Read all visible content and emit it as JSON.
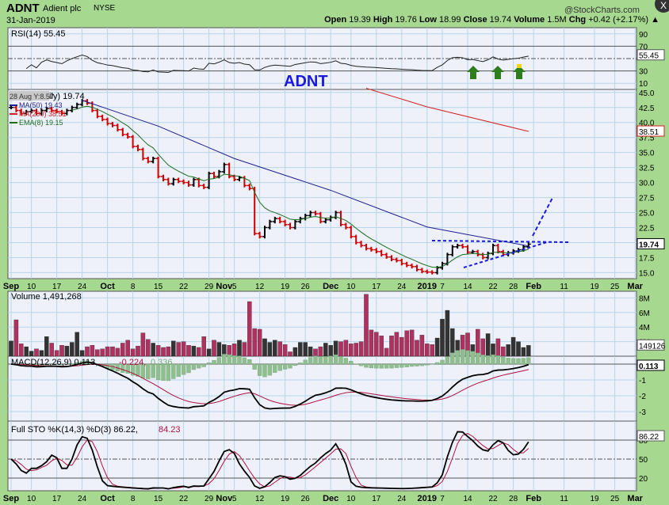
{
  "header": {
    "symbol": "ADNT",
    "name": "Adient plc",
    "exchange": "NYSE",
    "date": "31-Jan-2019",
    "brand": "@StockCharts.com",
    "quote": {
      "open_label": "Open",
      "open": "19.39",
      "high_label": "High",
      "high": "19.76",
      "low_label": "Low",
      "low": "18.99",
      "close_label": "Close",
      "close": "19.74",
      "volume_label": "Volume",
      "volume": "1.5M",
      "chg_label": "Chg",
      "chg": "+0.42 (+2.17%)"
    },
    "close_button": "X"
  },
  "annotation": {
    "ticker_text": "ADNT",
    "tooltip": "28 Aug Y:8.57",
    "colors": {
      "arrow": "#2e7d1e",
      "annotation": "#1a1adf"
    }
  },
  "chart_data": {
    "type": "ohlc",
    "dates": [
      "2018-09-04",
      "2018-09-05",
      "2018-09-06",
      "2018-09-07",
      "2018-09-10",
      "2018-09-11",
      "2018-09-12",
      "2018-09-13",
      "2018-09-14",
      "2018-09-17",
      "2018-09-18",
      "2018-09-19",
      "2018-09-20",
      "2018-09-21",
      "2018-09-24",
      "2018-09-25",
      "2018-09-26",
      "2018-09-27",
      "2018-09-28",
      "2018-10-01",
      "2018-10-02",
      "2018-10-03",
      "2018-10-04",
      "2018-10-05",
      "2018-10-08",
      "2018-10-09",
      "2018-10-10",
      "2018-10-11",
      "2018-10-12",
      "2018-10-15",
      "2018-10-16",
      "2018-10-17",
      "2018-10-18",
      "2018-10-19",
      "2018-10-22",
      "2018-10-23",
      "2018-10-24",
      "2018-10-25",
      "2018-10-26",
      "2018-10-29",
      "2018-10-30",
      "2018-10-31",
      "2018-11-01",
      "2018-11-02",
      "2018-11-05",
      "2018-11-06",
      "2018-11-07",
      "2018-11-08",
      "2018-11-09",
      "2018-11-12",
      "2018-11-13",
      "2018-11-14",
      "2018-11-15",
      "2018-11-16",
      "2018-11-19",
      "2018-11-20",
      "2018-11-21",
      "2018-11-23",
      "2018-11-26",
      "2018-11-27",
      "2018-11-28",
      "2018-11-29",
      "2018-11-30",
      "2018-12-03",
      "2018-12-04",
      "2018-12-06",
      "2018-12-07",
      "2018-12-10",
      "2018-12-11",
      "2018-12-12",
      "2018-12-13",
      "2018-12-14",
      "2018-12-17",
      "2018-12-18",
      "2018-12-19",
      "2018-12-20",
      "2018-12-21",
      "2018-12-24",
      "2018-12-26",
      "2018-12-27",
      "2018-12-28",
      "2018-12-31",
      "2019-01-02",
      "2019-01-03",
      "2019-01-04",
      "2019-01-07",
      "2019-01-08",
      "2019-01-09",
      "2019-01-10",
      "2019-01-11",
      "2019-01-14",
      "2019-01-15",
      "2019-01-16",
      "2019-01-17",
      "2019-01-18",
      "2019-01-22",
      "2019-01-23",
      "2019-01-24",
      "2019-01-25",
      "2019-01-28",
      "2019-01-29",
      "2019-01-30",
      "2019-01-31"
    ],
    "close": [
      42.5,
      42,
      41.5,
      41.8,
      42,
      41.5,
      42,
      42.3,
      42,
      41.8,
      41.5,
      42,
      42.5,
      43,
      43.6,
      43.2,
      42,
      41,
      40.5,
      39.8,
      39.5,
      38.8,
      38,
      37.6,
      36,
      35.5,
      34,
      33.5,
      34,
      31,
      30.5,
      29.8,
      30.5,
      30.2,
      30,
      29.6,
      30.5,
      29.5,
      29.2,
      31.5,
      31,
      31.8,
      33,
      31,
      30.5,
      30.8,
      29.5,
      29,
      21.5,
      21,
      22.5,
      23.5,
      24,
      23.5,
      23,
      22.5,
      23.5,
      24,
      24.5,
      25,
      24.8,
      23.5,
      23.8,
      24.2,
      25,
      23,
      22.5,
      21,
      20,
      19.5,
      19,
      18.8,
      18.5,
      18,
      17.6,
      17.2,
      17,
      16.5,
      16.2,
      16,
      15.5,
      15.2,
      15.1,
      15,
      15.8,
      16.5,
      18,
      19.3,
      19.5,
      19.3,
      18.4,
      18.5,
      18,
      17.5,
      18.2,
      19.5,
      18.5,
      18,
      18.3,
      18.6,
      18.8,
      19.3,
      19.74
    ],
    "volume_millions": [
      2.1,
      5.0,
      1.7,
      1.3,
      0.7,
      1.0,
      0.8,
      2.7,
      1.8,
      0.8,
      1.5,
      1.4,
      1.9,
      3.3,
      0.8,
      1.3,
      1.5,
      0.9,
      1.0,
      1.3,
      1.3,
      1.1,
      1.8,
      2.2,
      1.0,
      1.4,
      3.2,
      2.3,
      1.8,
      1.5,
      1.2,
      1.3,
      2.1,
      1.9,
      2.0,
      1.5,
      1.4,
      1.2,
      2.7,
      1.0,
      2.2,
      1.9,
      1.6,
      1.5,
      1.7,
      2.2,
      1.9,
      7.5,
      3.8,
      3.7,
      2.4,
      1.9,
      2.2,
      2.0,
      1.6,
      0.6,
      1.2,
      1.9,
      1.9,
      1.3,
      1.0,
      1.3,
      1.8,
      1.5,
      2.1,
      2.0,
      2.2,
      1.7,
      1.8,
      2.0,
      8.5,
      3.6,
      3.3,
      2.8,
      1.1,
      2.8,
      3.3,
      2.6,
      3.5,
      3.6,
      2.2,
      2.9,
      1.7,
      1.6,
      2.5,
      5.1,
      6.3,
      3.8,
      2.2,
      2.9,
      3.2,
      1.6,
      3.7,
      2.4,
      3.1,
      1.7,
      2.4,
      1.3,
      1.6,
      2.6,
      2.0,
      1.2,
      1.49
    ],
    "ma50": [
      [
        "2018-09-24",
        43.7
      ],
      [
        "2018-10-15",
        39.4
      ],
      [
        "2018-11-05",
        34.0
      ],
      [
        "2018-12-03",
        28.7
      ],
      [
        "2019-01-02",
        22.6
      ],
      [
        "2019-01-31",
        19.43
      ]
    ],
    "ma200": [
      [
        "2018-12-13",
        45.7
      ],
      [
        "2019-01-02",
        42.6
      ],
      [
        "2019-01-31",
        38.51
      ]
    ],
    "x_ticks": [
      [
        "Sep",
        "2018-09-04",
        true
      ],
      [
        "10",
        "2018-09-10",
        false
      ],
      [
        "17",
        "2018-09-17",
        false
      ],
      [
        "24",
        "2018-09-24",
        false
      ],
      [
        "Oct",
        "2018-10-01",
        true
      ],
      [
        "8",
        "2018-10-08",
        false
      ],
      [
        "15",
        "2018-10-15",
        false
      ],
      [
        "22",
        "2018-10-22",
        false
      ],
      [
        "29",
        "2018-10-29",
        false
      ],
      [
        "Nov",
        "2018-11-01",
        true
      ],
      [
        "5",
        "2018-11-05",
        false
      ],
      [
        "12",
        "2018-11-12",
        false
      ],
      [
        "19",
        "2018-11-19",
        false
      ],
      [
        "26",
        "2018-11-26",
        false
      ],
      [
        "Dec",
        "2018-12-03",
        true
      ],
      [
        "10",
        "2018-12-10",
        false
      ],
      [
        "17",
        "2018-12-17",
        false
      ],
      [
        "24",
        "2018-12-24",
        false
      ],
      [
        "2019",
        "2019-01-02",
        true
      ],
      [
        "7",
        "2019-01-07",
        false
      ],
      [
        "14",
        "2019-01-14",
        false
      ],
      [
        "22",
        "2019-01-22",
        false
      ],
      [
        "28",
        "2019-01-28",
        false
      ],
      [
        "Feb",
        "2019-02-01",
        true
      ],
      [
        "11",
        "2019-02-11",
        false
      ],
      [
        "19",
        "2019-02-19",
        false
      ],
      [
        "25",
        "2019-02-25",
        false
      ],
      [
        "Mar",
        "2019-03-01",
        true
      ]
    ],
    "price_axis": {
      "ylim": [
        14,
        46
      ],
      "ticks": [
        "15.0",
        "17.5",
        "20.0",
        "22.5",
        "25.0",
        "27.5",
        "30.0",
        "32.5",
        "35.0",
        "37.5",
        "40.0",
        "42.5",
        "45.0"
      ]
    },
    "price_legend": {
      "title_tail": "ily) 19.74",
      "ma50": "MA(50) 19.43",
      "ma200": "MA(200) 38.51",
      "ema8": "EMA(8) 19.15"
    },
    "price_tags": {
      "close": "19.74",
      "ma200": "38.51"
    },
    "rsi": {
      "label": "RSI(14) 55.45",
      "tag": "55.45",
      "ticks": [
        "90",
        "70",
        "30",
        "10"
      ]
    },
    "volume": {
      "label": "Volume 1,491,268",
      "tag": "149126",
      "ticks": [
        "8M",
        "6M",
        "4M",
        "2M"
      ]
    },
    "macd": {
      "label": "MACD(12,26,9) 0.113,",
      "signal": "-0.224,",
      "hist": "0.336",
      "tags": [
        "0.336",
        "0.113",
        "-0.224"
      ],
      "ticks": [
        "-1",
        "-2",
        "-3"
      ]
    },
    "sto": {
      "label": "Full STO %K(14,3) %D(3) 86.22,",
      "d": "84.23",
      "tag": "86.22",
      "ticks": [
        "80",
        "50",
        "20"
      ]
    },
    "colors": {
      "up": "#000000",
      "down": "#cc0000",
      "vol_up": "#333333",
      "vol_down": "#b03060",
      "ma50": "#1f1f8f",
      "ma200": "#d42020",
      "ema8": "#1e6e1e",
      "macd_hist": "#8fbf8f",
      "signal": "#b01040",
      "panel_bg": "#eef1fa",
      "grid": "#b7d6ea"
    }
  }
}
